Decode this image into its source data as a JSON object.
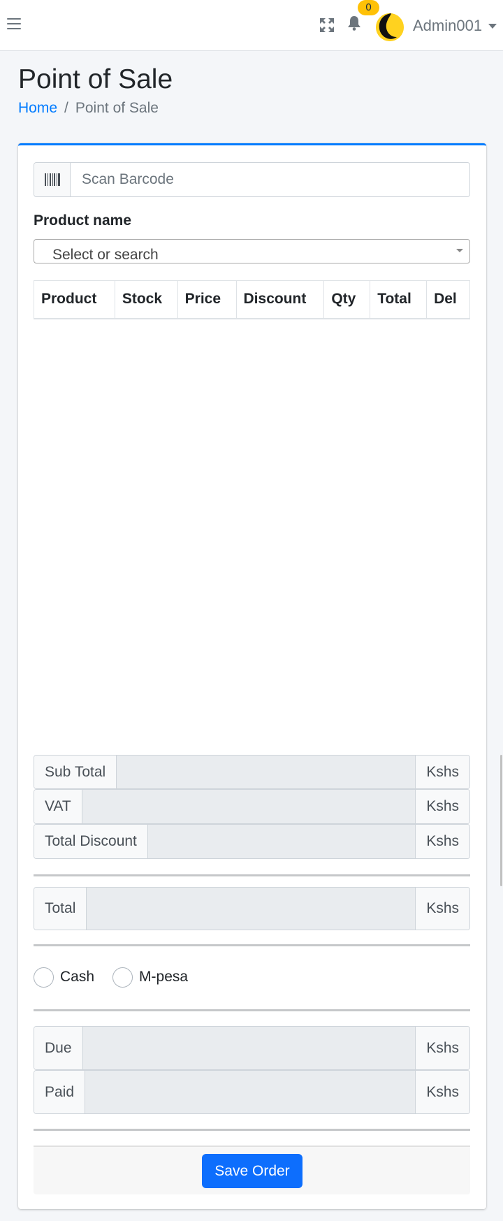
{
  "navbar": {
    "notification_count": "0",
    "user_name": "Admin001"
  },
  "header": {
    "title": "Point of Sale",
    "breadcrumb": [
      {
        "label": "Home"
      },
      {
        "label": "Point of Sale"
      }
    ]
  },
  "form": {
    "barcode_placeholder": "Scan Barcode",
    "product_label": "Product name",
    "product_select_placeholder": "Select or search"
  },
  "table": {
    "columns": [
      "Product",
      "Stock",
      "Price",
      "Discount",
      "Qty",
      "Total",
      "Del"
    ]
  },
  "totals": {
    "subtotal_label": "Sub Total",
    "vat_label": "VAT",
    "total_discount_label": "Total Discount",
    "total_label": "Total",
    "due_label": "Due",
    "paid_label": "Paid",
    "currency": "Kshs"
  },
  "payment": {
    "options": [
      "Cash",
      "M-pesa"
    ]
  },
  "actions": {
    "save_label": "Save Order"
  },
  "colors": {
    "primary": "#007bff",
    "button": "#0d6efd",
    "badge": "#ffc107"
  }
}
